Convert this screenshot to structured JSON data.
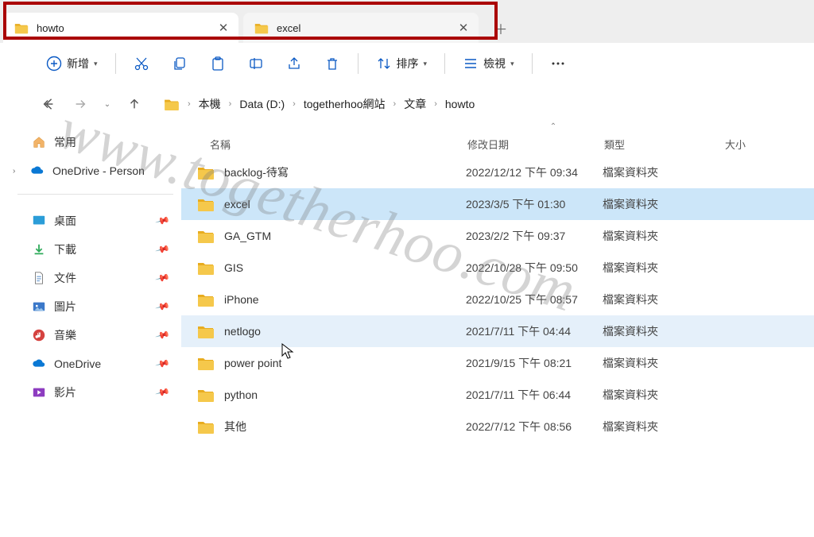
{
  "tabs": [
    {
      "label": "howto",
      "active": true
    },
    {
      "label": "excel",
      "active": false
    }
  ],
  "toolbar": {
    "new_label": "新增",
    "sort_label": "排序",
    "view_label": "檢視"
  },
  "breadcrumb": [
    "本機",
    "Data (D:)",
    "togetherhoo網站",
    "文章",
    "howto"
  ],
  "sidebar": {
    "home": "常用",
    "onedrive": "OneDrive - Person",
    "quick": [
      {
        "label": "桌面",
        "icon": "desktop"
      },
      {
        "label": "下載",
        "icon": "download"
      },
      {
        "label": "文件",
        "icon": "documents"
      },
      {
        "label": "圖片",
        "icon": "pictures"
      },
      {
        "label": "音樂",
        "icon": "music"
      },
      {
        "label": "OneDrive",
        "icon": "cloud"
      },
      {
        "label": "影片",
        "icon": "videos"
      }
    ]
  },
  "columns": {
    "name": "名稱",
    "date": "修改日期",
    "type": "類型",
    "size": "大小"
  },
  "rows": [
    {
      "name": "backlog-待寫",
      "date": "2022/12/12 下午 09:34",
      "type": "檔案資料夾",
      "state": ""
    },
    {
      "name": "excel",
      "date": "2023/3/5 下午 01:30",
      "type": "檔案資料夾",
      "state": "selected"
    },
    {
      "name": "GA_GTM",
      "date": "2023/2/2 下午 09:37",
      "type": "檔案資料夾",
      "state": ""
    },
    {
      "name": "GIS",
      "date": "2022/10/28 下午 09:50",
      "type": "檔案資料夾",
      "state": ""
    },
    {
      "name": "iPhone",
      "date": "2022/10/25 下午 08:57",
      "type": "檔案資料夾",
      "state": ""
    },
    {
      "name": "netlogo",
      "date": "2021/7/11 下午 04:44",
      "type": "檔案資料夾",
      "state": "hover"
    },
    {
      "name": "power point",
      "date": "2021/9/15 下午 08:21",
      "type": "檔案資料夾",
      "state": ""
    },
    {
      "name": "python",
      "date": "2021/7/11 下午 06:44",
      "type": "檔案資料夾",
      "state": ""
    },
    {
      "name": "其他",
      "date": "2022/7/12 下午 08:56",
      "type": "檔案資料夾",
      "state": ""
    }
  ],
  "watermark": "www.togetherhoo.com"
}
